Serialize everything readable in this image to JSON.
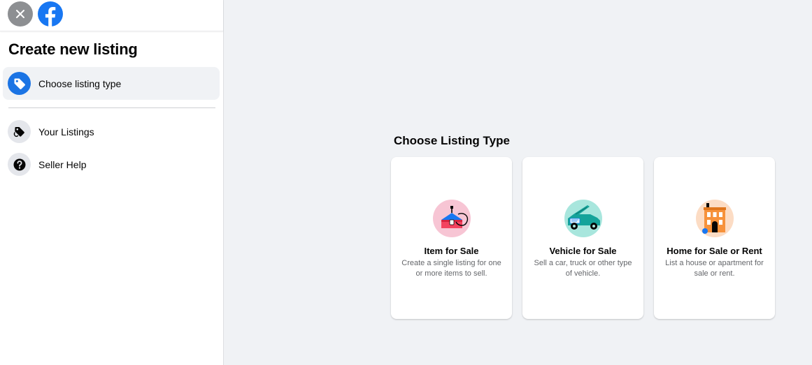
{
  "sidebar": {
    "title": "Create new listing",
    "items": [
      {
        "label": "Choose listing type",
        "icon": "tag-icon",
        "active": true
      },
      {
        "label": "Your Listings",
        "icon": "tags-icon",
        "active": false
      },
      {
        "label": "Seller Help",
        "icon": "question-icon",
        "active": false
      }
    ]
  },
  "main": {
    "heading": "Choose Listing Type",
    "cards": [
      {
        "title": "Item for Sale",
        "description": "Create a single listing for one or more items to sell.",
        "icon": "item-for-sale-icon"
      },
      {
        "title": "Vehicle for Sale",
        "description": "Sell a car, truck or other type of vehicle.",
        "icon": "vehicle-icon"
      },
      {
        "title": "Home for Sale or Rent",
        "description": "List a house or apartment for sale or rent.",
        "icon": "home-icon"
      }
    ]
  },
  "colors": {
    "brand": "#1877f2",
    "active_icon": "#1b74e4",
    "page_bg": "#f0f2f5"
  }
}
